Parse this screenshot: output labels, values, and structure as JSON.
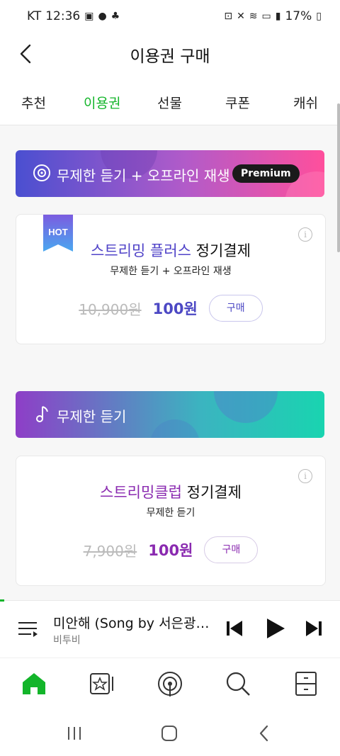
{
  "status_bar": {
    "carrier": "KT",
    "time": "12:36",
    "battery": "17%"
  },
  "header": {
    "title": "이용권 구매"
  },
  "tabs": [
    {
      "label": "추천",
      "active": false
    },
    {
      "label": "이용권",
      "active": true
    },
    {
      "label": "선물",
      "active": false
    },
    {
      "label": "쿠폰",
      "active": false
    },
    {
      "label": "캐쉬",
      "active": false
    }
  ],
  "banners": [
    {
      "text": "무제한 듣기 + 오프라인 재생",
      "badge": "Premium",
      "icon": "cd-icon"
    },
    {
      "text": "무제한 듣기",
      "icon": "music-note-icon"
    }
  ],
  "products": [
    {
      "hot_label": "HOT",
      "name": "스트리밍 플러스",
      "plan": "정기결제",
      "description": "무제한 듣기 + 오프라인 재생",
      "original_price": "10,900원",
      "price": "100원",
      "buy_label": "구매"
    },
    {
      "name": "스트리밍클럽",
      "plan": "정기결제",
      "description": "무제한 듣기",
      "original_price": "7,900원",
      "price": "100원",
      "buy_label": "구매"
    }
  ],
  "player": {
    "song": "미안해 (Song by 서은광,...",
    "artist": "비투비"
  },
  "colors": {
    "accent_green": "#13b52a",
    "purple_blue": "#4c48c4",
    "purple": "#8a2ab0"
  }
}
